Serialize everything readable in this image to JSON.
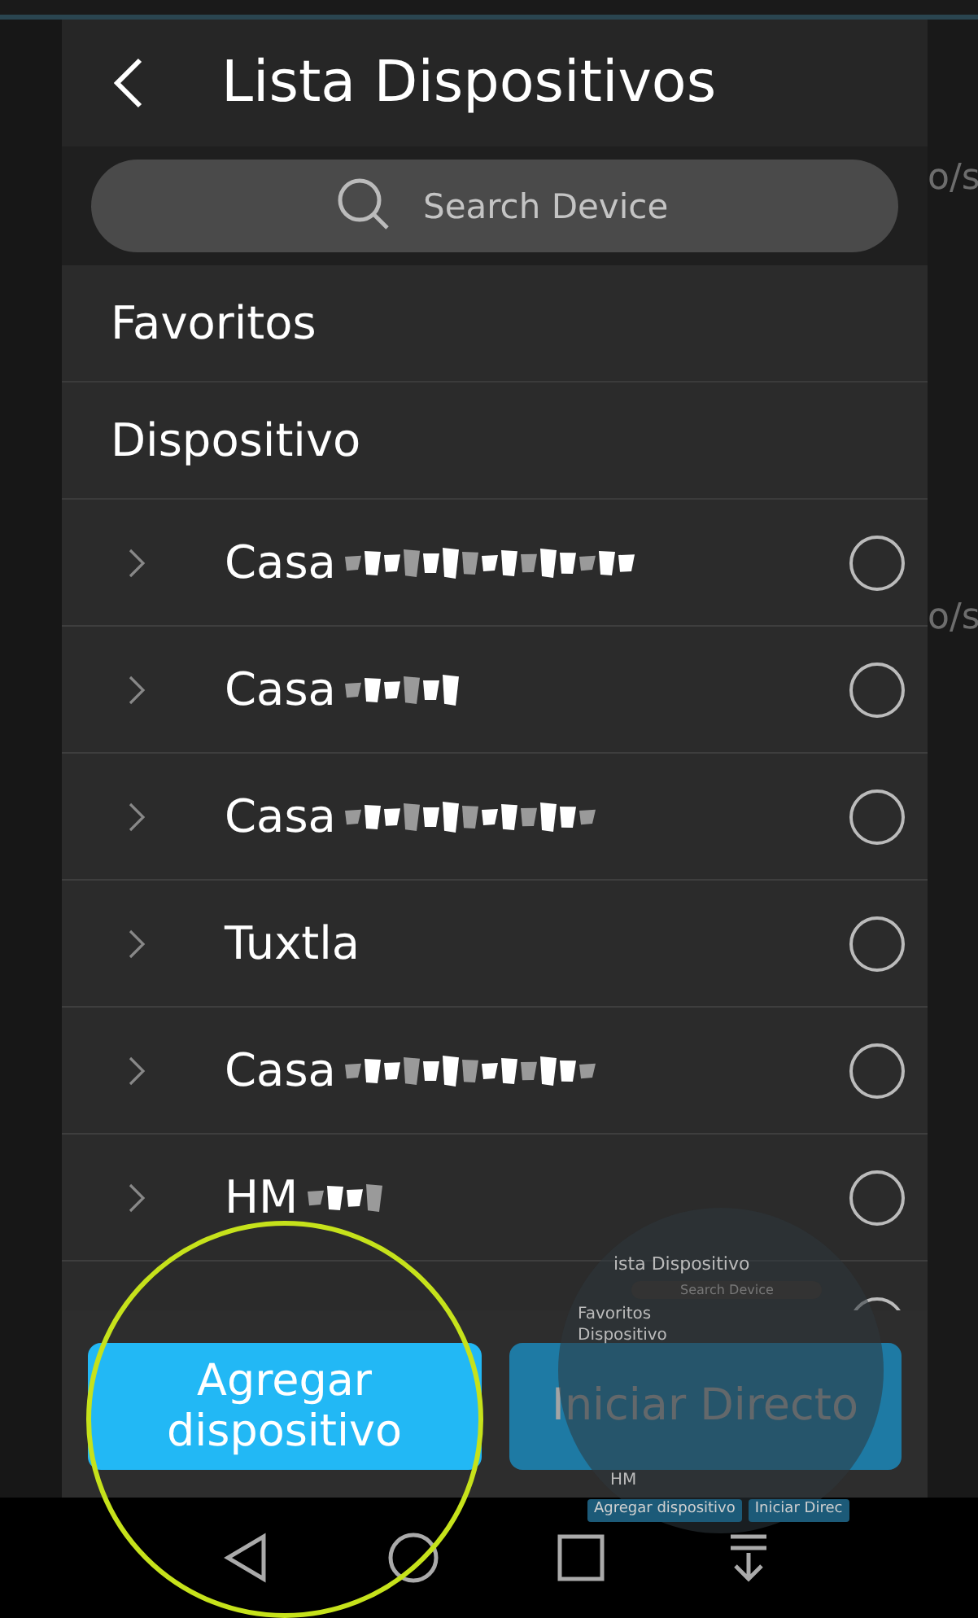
{
  "background_app": {
    "texts": [
      "o/s",
      "o/s"
    ]
  },
  "header": {
    "title": "Lista Dispositivos"
  },
  "search": {
    "placeholder": "Search Device"
  },
  "sections": [
    {
      "label": "Favoritos"
    },
    {
      "label": "Dispositivo"
    }
  ],
  "devices": [
    {
      "name": "Casa",
      "redacted": true,
      "selected": false
    },
    {
      "name": "Casa",
      "redacted": true,
      "selected": false
    },
    {
      "name": "Casa",
      "redacted": true,
      "selected": false
    },
    {
      "name": "Tuxtla",
      "redacted": false,
      "selected": false
    },
    {
      "name": "Casa",
      "redacted": true,
      "selected": false
    },
    {
      "name": "HM",
      "redacted": true,
      "selected": false
    }
  ],
  "partial_device": {
    "selected": false
  },
  "buttons": [
    {
      "label": "Agregar dispositivo",
      "disabled": false
    },
    {
      "label": "Iniciar Directo",
      "disabled": true
    }
  ],
  "magnifier": {
    "title": "ista Dispositivo",
    "search": "Search Device",
    "items": [
      "Favoritos",
      "Dispositivo"
    ],
    "device": "HM",
    "buttons": [
      "Agregar dispositivo",
      "Iniciar Direc"
    ]
  }
}
